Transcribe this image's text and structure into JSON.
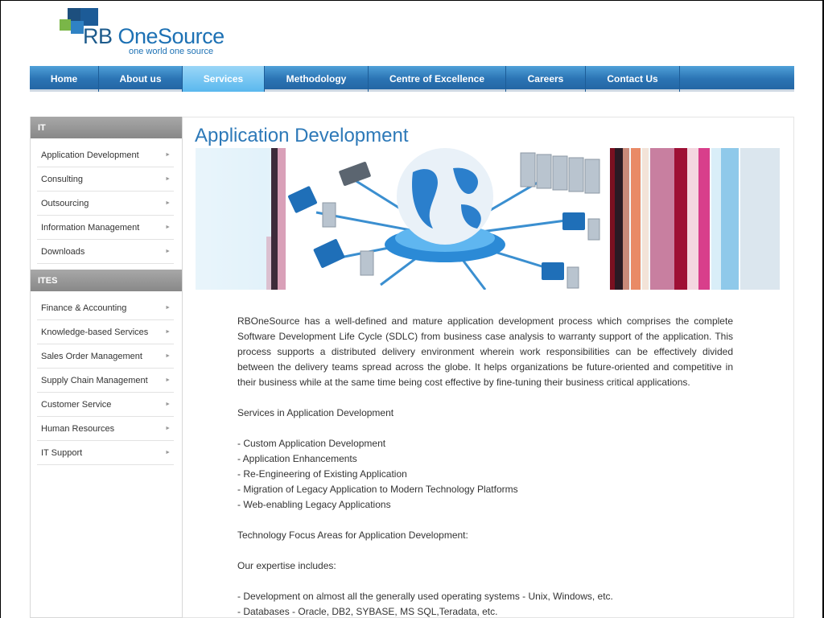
{
  "logo": {
    "brand_prefix": "RB ",
    "brand_name": "OneSource",
    "tagline": "one world one source"
  },
  "nav": {
    "items": [
      {
        "label": "Home",
        "active": false
      },
      {
        "label": "About us",
        "active": false
      },
      {
        "label": "Services",
        "active": true
      },
      {
        "label": "Methodology",
        "active": false
      },
      {
        "label": "Centre of Excellence",
        "active": false
      },
      {
        "label": "Careers",
        "active": false
      },
      {
        "label": "Contact Us",
        "active": false
      }
    ]
  },
  "sidebar": {
    "sections": [
      {
        "heading": "IT",
        "items": [
          "Application Development",
          "Consulting",
          "Outsourcing",
          "Information Management",
          "Downloads"
        ]
      },
      {
        "heading": "ITES",
        "items": [
          "Finance & Accounting",
          "Knowledge-based Services",
          "Sales Order Management",
          "Supply Chain Management",
          "Customer Service",
          "Human Resources",
          "IT Support"
        ]
      }
    ]
  },
  "main": {
    "title": "Application Development",
    "intro": "RBOneSource has a well-defined and mature application development process which comprises the complete Software Development Life Cycle (SDLC) from business case analysis to warranty support of the application. This process supports a distributed delivery environment wherein work responsibilities can be effectively divided between the delivery teams spread across the globe. It helps organizations be future-oriented and competitive in their business while at the same time being cost effective by fine-tuning their business critical applications.",
    "services_heading": "Services in Application Development",
    "services": [
      "- Custom Application Development",
      "- Application Enhancements",
      "- Re-Engineering of Existing Application",
      "- Migration of Legacy Application to Modern Technology Platforms",
      "- Web-enabling Legacy Applications"
    ],
    "tech_heading": "Technology Focus Areas for Application Development:",
    "expertise_heading": "Our expertise includes:",
    "expertise": [
      "- Development on almost all the generally used operating systems - Unix, Windows, etc.",
      "- Databases - Oracle, DB2, SYBASE, MS SQL,Teradata, etc."
    ]
  },
  "colors": {
    "nav_blue": "#2b74b4",
    "nav_active": "#5ab8ee",
    "title_blue": "#2d79b8",
    "sidebar_head": "#999999"
  },
  "icons": {
    "sidebar_arrow": "triangle-right-icon",
    "logo_mark": "logo-squares-icon",
    "banner": "globe-network-illustration"
  }
}
